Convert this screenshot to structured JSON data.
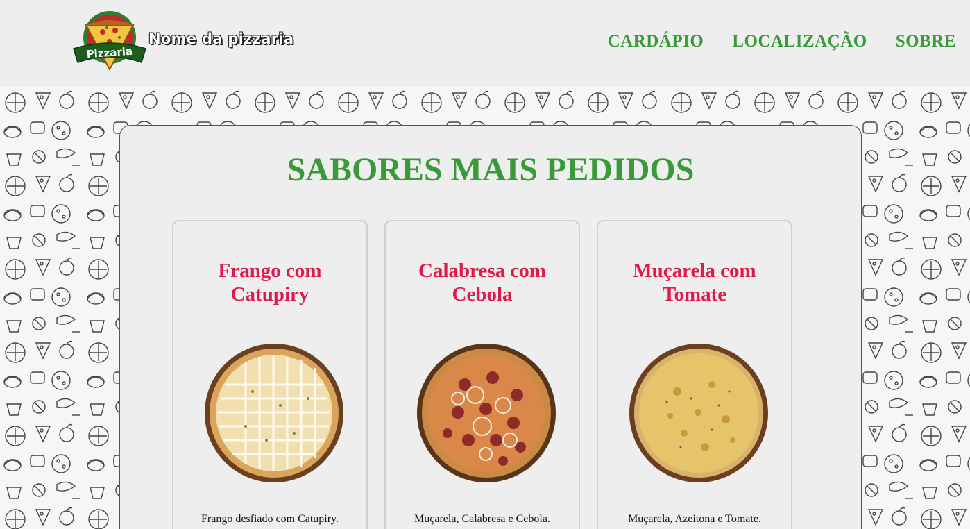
{
  "header": {
    "brand_name": "Nome da pizzaria",
    "logo_text": "Pizzaria",
    "nav": [
      {
        "label": "CARDÁPIO"
      },
      {
        "label": "LOCALIZAÇÃO"
      },
      {
        "label": "SOBRE"
      }
    ]
  },
  "main": {
    "title": "SABORES MAIS PEDIDOS",
    "cards": [
      {
        "title_line1": "Frango com",
        "title_line2": "Catupiry",
        "description": "Frango desfiado com Catupiry.",
        "pizza_icon": "pizza-frango-catupiry"
      },
      {
        "title_line1": "Calabresa com",
        "title_line2": "Cebola",
        "description": "Muçarela, Calabresa e Cebola.",
        "pizza_icon": "pizza-calabresa-cebola"
      },
      {
        "title_line1": "Muçarela com",
        "title_line2": "Tomate",
        "description": "Muçarela, Azeitona e Tomate.",
        "pizza_icon": "pizza-mucarela-tomate"
      }
    ]
  },
  "colors": {
    "accent_green": "#3a9a3a",
    "card_title_red": "#e0194a",
    "background": "#eeeeee"
  }
}
